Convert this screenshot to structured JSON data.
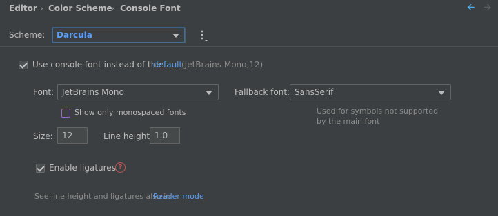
{
  "breadcrumb": {
    "items": [
      "Editor",
      "Color Scheme",
      "Console Font"
    ],
    "separator": "›"
  },
  "nav": {
    "back_icon": "arrow-left-icon",
    "forward_icon": "arrow-right-icon",
    "back_color": "#4eade5",
    "forward_color": "#5e6060"
  },
  "scheme": {
    "label": "Scheme:",
    "value": "Darcula",
    "more_icon": "more-vertical-icon"
  },
  "use_console_font": {
    "checked": true,
    "label_prefix": "Use console font instead of the",
    "link": "default",
    "suffix": "(JetBrains Mono,12)"
  },
  "font": {
    "label": "Font:",
    "value": "JetBrains Mono"
  },
  "fallback_font": {
    "label": "Fallback font:",
    "value": "SansSerif",
    "hint_line1": "Used for symbols not supported",
    "hint_line2": "by the main font"
  },
  "monospaced": {
    "checked": false,
    "label": "Show only monospaced fonts"
  },
  "size": {
    "label": "Size:",
    "value": "12"
  },
  "line_height": {
    "label": "Line height:",
    "value": "1.0"
  },
  "ligatures": {
    "checked": true,
    "label": "Enable ligatures",
    "help_icon": "help-circle-icon"
  },
  "footer": {
    "text": "See line height and ligatures also in",
    "link": "Reader mode"
  },
  "colors": {
    "background": "#3c3f41",
    "link": "#589df6",
    "scheme_value": "#589df6",
    "focus_border": "#3d6185"
  }
}
